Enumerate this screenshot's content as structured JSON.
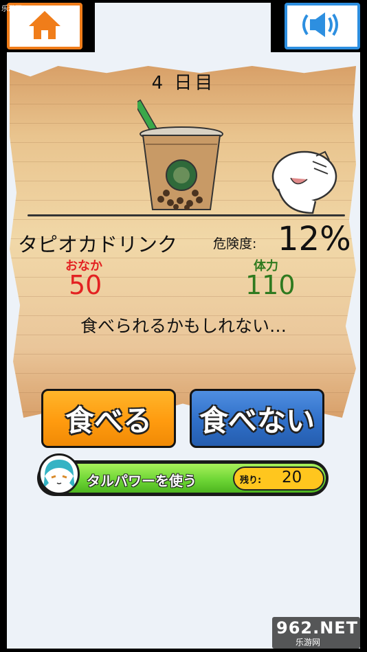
{
  "watermark": {
    "top": "乐游网 www.962.net",
    "logo_main": "962.NET",
    "logo_sub": "乐游网"
  },
  "icons": {
    "home": "home-icon",
    "sound": "speaker-sound-icon",
    "drink": "tapioca-drink-illustration",
    "character": "character-illustration",
    "avatar": "taru-avatar-icon"
  },
  "colors": {
    "home_border": "#f07d1a",
    "sound_border": "#2d8fe0",
    "hunger": "#e32222",
    "stamina": "#2f7a1f",
    "eat_button": "#ff9b0f",
    "not_eat_button": "#2f6fc8",
    "power_bar": "#6ed636",
    "remaining_box": "#ffc61e"
  },
  "game": {
    "day": "4 日目",
    "food_name": "タピオカドリンク",
    "danger_label": "危険度:",
    "danger_value": "12%",
    "hunger_label": "おなか",
    "hunger_value": "50",
    "stamina_label": "体力",
    "stamina_value": "110",
    "message": "食べられるかもしれない…"
  },
  "actions": {
    "eat": "食べる",
    "not_eat": "食べない"
  },
  "power": {
    "label": "タルパワーを使う",
    "remaining_label": "残り:",
    "remaining_value": "20"
  }
}
